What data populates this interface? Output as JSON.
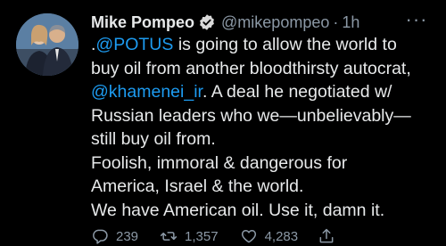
{
  "author": {
    "name": "Mike Pompeo",
    "handle": "@mikepompeo",
    "separator": "·",
    "time": "1h"
  },
  "more_label": "···",
  "tweet": {
    "lines": [
      {
        "prefix": ".",
        "link": "@POTUS",
        "text": " is going to allow the world to"
      },
      {
        "text": "buy oil from another bloodthirsty autocrat,"
      },
      {
        "link": "@khamenei_ir",
        "text": ". A deal he negotiated w/"
      },
      {
        "text": "Russian leaders who we—unbelievably—"
      },
      {
        "text": "still buy oil from."
      },
      {
        "text": "Foolish, immoral & dangerous for"
      },
      {
        "text": "America, Israel & the world."
      },
      {
        "text": "We have American oil. Use it, damn it."
      }
    ]
  },
  "stats": {
    "replies": "239",
    "retweets": "1,357",
    "likes": "4,283"
  },
  "icons": {
    "verified": "verified-badge-icon",
    "reply": "reply-icon",
    "retweet": "retweet-icon",
    "like": "heart-icon",
    "share": "share-icon"
  },
  "colors": {
    "background": "#000000",
    "text": "#e7e9ea",
    "secondary": "#8b98a5",
    "link": "#1d9bf0"
  }
}
